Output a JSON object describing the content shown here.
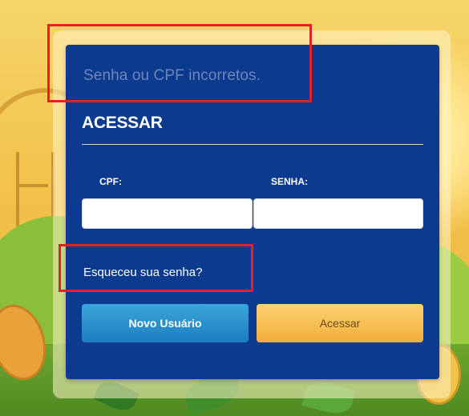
{
  "login": {
    "error_message": "Senha ou CPF incorretos.",
    "title": "ACESSAR",
    "cpf_label": "CPF:",
    "cpf_value": "",
    "senha_label": "SENHA:",
    "senha_value": "",
    "forgot_password": "Esqueceu sua senha?",
    "new_user_button": "Novo Usuário",
    "access_button": "Acessar"
  },
  "colors": {
    "panel_bg": "#0c3a8e",
    "error_text": "#6f86b9",
    "new_user_button": "#1d7dbf",
    "access_button": "#f3ad3a",
    "highlight": "#e0212a"
  },
  "icons": []
}
